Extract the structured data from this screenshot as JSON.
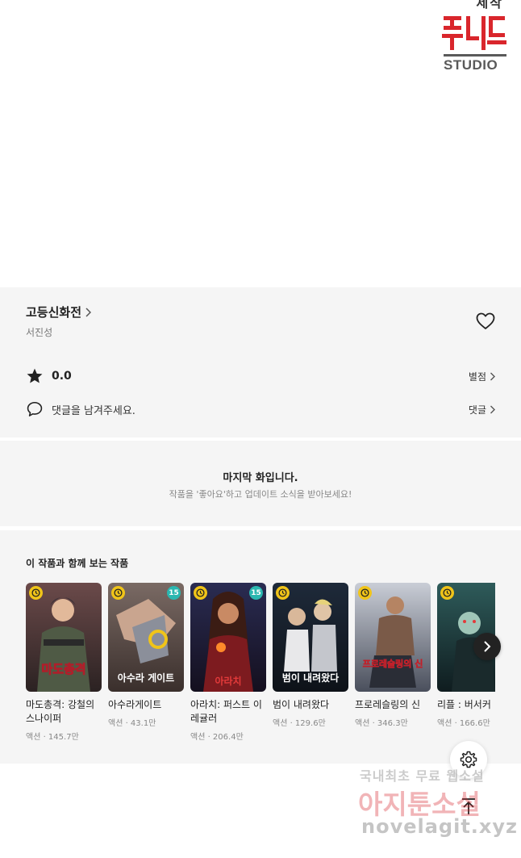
{
  "banner": {
    "top_text": "제작",
    "logo_text": "STUDIO"
  },
  "work": {
    "title": "고등신화전",
    "author": "서진성"
  },
  "rating": {
    "value": "0.0",
    "rate_label": "별점"
  },
  "comments": {
    "prompt": "댓글을 남겨주세요.",
    "link_label": "댓글"
  },
  "last_episode": {
    "title": "마지막 화입니다.",
    "subtitle": "작품을 '좋아요'하고 업데이트 소식을 받아보세요!"
  },
  "recommendations": {
    "heading": "이 작품과 함께 보는 작품",
    "items": [
      {
        "name": "마도총격: 강철의 스나이퍼",
        "meta": "액션 · 145.7만",
        "cover_text": "마도총격",
        "age": ""
      },
      {
        "name": "아수라게이트",
        "meta": "액션 · 43.1만",
        "cover_text": "아수라 게이트",
        "age": "15"
      },
      {
        "name": "아라치: 퍼스트 이레귤러",
        "meta": "액션 · 206.4만",
        "cover_text": "아라치",
        "age": "15"
      },
      {
        "name": "범이 내려왔다",
        "meta": "액션 · 129.6만",
        "cover_text": "범이 내려왔다",
        "age": ""
      },
      {
        "name": "프로레슬링의 신",
        "meta": "액션 · 346.3만",
        "cover_text": "프로레슬링의 신",
        "age": ""
      },
      {
        "name": "리플 : 버서커",
        "meta": "액션 · 166.6만",
        "cover_text": "",
        "age": ""
      }
    ]
  },
  "watermark": {
    "line1": "국내최초 무료 웹소설",
    "line2": "아지툰소설",
    "line3": "novelagit.xyz"
  },
  "colors": {
    "panel_bg": "#f5f5f5",
    "logo_red": "#d9262c",
    "clock_badge": "#f0c419",
    "age_badge": "#2bb7b0"
  },
  "icons": [
    "chevron-right-icon",
    "heart-icon",
    "star-icon",
    "comment-icon",
    "clock-icon",
    "gear-icon",
    "arrow-up-icon"
  ]
}
